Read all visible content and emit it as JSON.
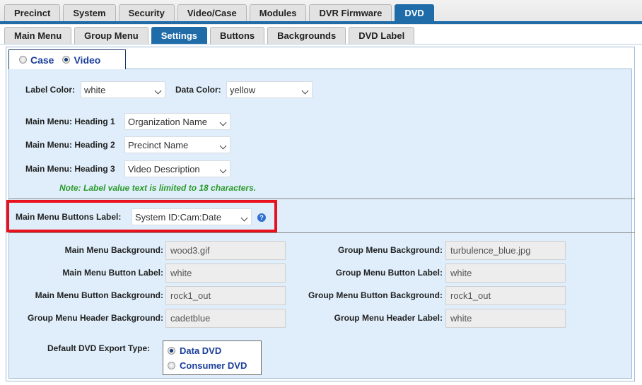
{
  "top_tabs": [
    "Precinct",
    "System",
    "Security",
    "Video/Case",
    "Modules",
    "DVR Firmware",
    "DVD"
  ],
  "sub_tabs": [
    "Main Menu",
    "Group Menu",
    "Settings",
    "Buttons",
    "Backgrounds",
    "DVD Label"
  ],
  "mode": {
    "case_label": "Case",
    "video_label": "Video",
    "selected": "Video"
  },
  "colors": {
    "label_color_label": "Label Color:",
    "label_color_value": "white",
    "data_color_label": "Data Color:",
    "data_color_value": "yellow"
  },
  "headings": [
    {
      "label": "Main Menu: Heading 1",
      "value": "Organization Name"
    },
    {
      "label": "Main Menu: Heading 2",
      "value": "Precinct Name"
    },
    {
      "label": "Main Menu: Heading 3",
      "value": "Video Description"
    }
  ],
  "note": "Note: Label value text is limited to 18 characters.",
  "buttons_label": {
    "label": "Main Menu Buttons Label:",
    "value": "System ID:Cam:Date"
  },
  "fields_left": [
    {
      "label": "Main Menu Background:",
      "value": "wood3.gif"
    },
    {
      "label": "Main Menu Button Label:",
      "value": "white"
    },
    {
      "label": "Main Menu Button Background:",
      "value": "rock1_out"
    },
    {
      "label": "Group Menu Header Background:",
      "value": "cadetblue"
    }
  ],
  "fields_right": [
    {
      "label": "Group Menu Background:",
      "value": "turbulence_blue.jpg"
    },
    {
      "label": "Group Menu Button Label:",
      "value": "white"
    },
    {
      "label": "Group Menu Button Background:",
      "value": "rock1_out"
    },
    {
      "label": "Group Menu Header Label:",
      "value": "white"
    }
  ],
  "export": {
    "label": "Default DVD Export Type:",
    "options": [
      "Data DVD",
      "Consumer DVD"
    ],
    "selected": "Data DVD"
  },
  "accent": "#1f6ca8",
  "highlight": "#e8121c",
  "note_color": "#2a9a2a"
}
